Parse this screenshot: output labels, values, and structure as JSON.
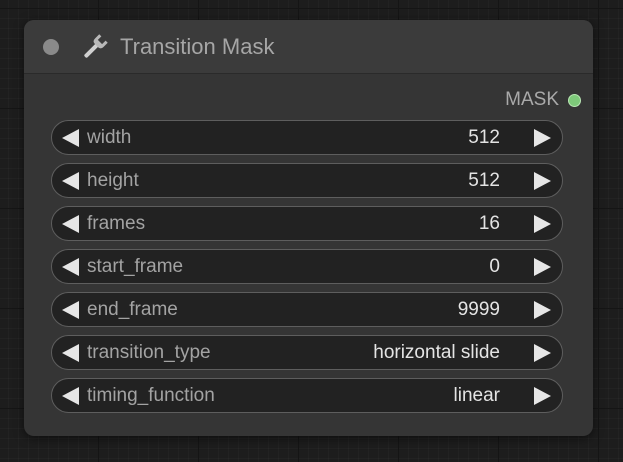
{
  "node": {
    "title": "Transition Mask",
    "icon": "wrench-icon",
    "output": {
      "label": "MASK",
      "color": "#7ec97a"
    },
    "widgets": [
      {
        "label": "width",
        "value": "512"
      },
      {
        "label": "height",
        "value": "512"
      },
      {
        "label": "frames",
        "value": "16"
      },
      {
        "label": "start_frame",
        "value": "0"
      },
      {
        "label": "end_frame",
        "value": "9999"
      },
      {
        "label": "transition_type",
        "value": "horizontal slide"
      },
      {
        "label": "timing_function",
        "value": "linear"
      }
    ]
  }
}
